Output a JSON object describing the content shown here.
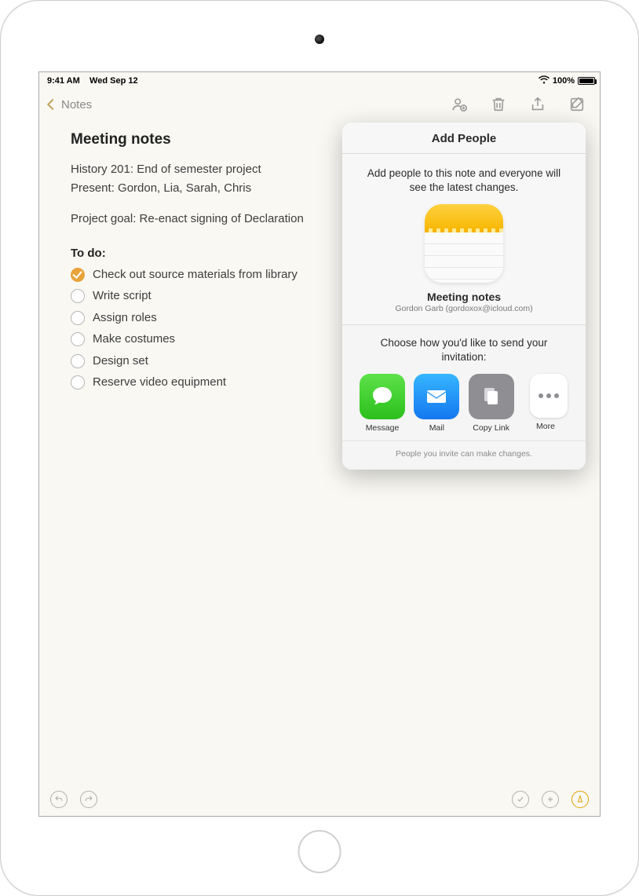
{
  "status": {
    "time": "9:41 AM",
    "date": "Wed Sep 12",
    "battery_pct": "100%"
  },
  "nav": {
    "back_label": "Notes"
  },
  "note": {
    "title": "Meeting notes",
    "line1": "History 201: End of semester project",
    "line2": "Present: Gordon, Lia, Sarah, Chris",
    "line3": "Project goal: Re-enact signing of Declaration",
    "todo_header": "To do:",
    "items": [
      {
        "label": "Check out source materials from library",
        "checked": true
      },
      {
        "label": "Write script",
        "checked": false
      },
      {
        "label": "Assign roles",
        "checked": false
      },
      {
        "label": "Make costumes",
        "checked": false
      },
      {
        "label": "Design set",
        "checked": false
      },
      {
        "label": "Reserve video equipment",
        "checked": false
      }
    ]
  },
  "popover": {
    "title": "Add People",
    "description": "Add people to this note and everyone will see the latest changes.",
    "note_title": "Meeting notes",
    "owner": "Gordon Garb (gordoxox@icloud.com)",
    "invite_prompt": "Choose how you'd like to send your invitation:",
    "share": {
      "message": "Message",
      "mail": "Mail",
      "copy": "Copy Link",
      "more": "More"
    },
    "footer": "People you invite can make changes."
  }
}
